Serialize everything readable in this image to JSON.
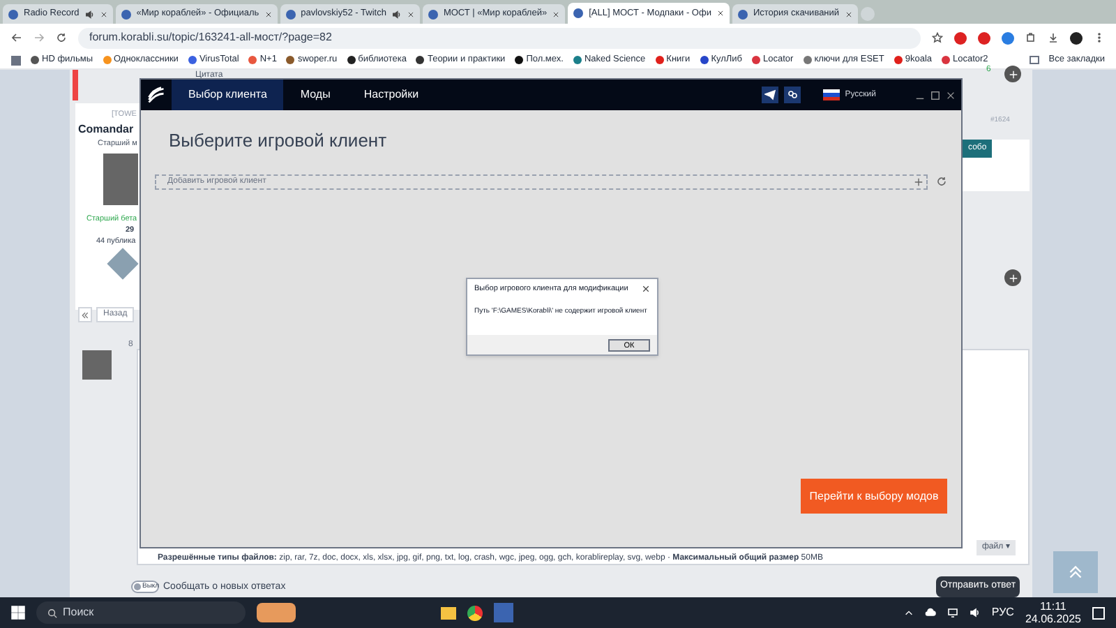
{
  "browser": {
    "tabs": [
      {
        "title": "Radio Record",
        "audio": true,
        "selected": false
      },
      {
        "title": "«Мир кораблей» - Официаль",
        "audio": false,
        "selected": false
      },
      {
        "title": "pavlovskiy52 - Twitch",
        "audio": true,
        "selected": false
      },
      {
        "title": "МОСТ | «Мир кораблей»",
        "audio": false,
        "selected": false
      },
      {
        "title": "[ALL] МОСТ - Модпаки - Офи",
        "audio": false,
        "selected": true
      },
      {
        "title": "История скачиваний",
        "audio": false,
        "selected": false
      }
    ],
    "address": "forum.korabli.su/topic/163241-all-мост/?page=82",
    "bookmarks": [
      {
        "label": "HD фильмы",
        "color": "#555555"
      },
      {
        "label": "Одноклассники",
        "color": "#f7931e"
      },
      {
        "label": "VirusTotal",
        "color": "#3b61e0"
      },
      {
        "label": "N+1",
        "color": "#e8573f"
      },
      {
        "label": "swoper.ru",
        "color": "#8a5a2b"
      },
      {
        "label": "библиотека",
        "color": "#222222"
      },
      {
        "label": "Теории и практики",
        "color": "#333333"
      },
      {
        "label": "Пол.мех.",
        "color": "#111111"
      },
      {
        "label": "Naked Science",
        "color": "#1b7f8a"
      },
      {
        "label": "Книги",
        "color": "#e0201b"
      },
      {
        "label": "КулЛиб",
        "color": "#2746c9"
      },
      {
        "label": "Locator",
        "color": "#d9343f"
      },
      {
        "label": "ключи для ESET",
        "color": "#777777"
      },
      {
        "label": "9koala",
        "color": "#e0201b"
      },
      {
        "label": "Locator2",
        "color": "#d9343f"
      }
    ],
    "all_bookmarks": "Все закладки"
  },
  "forum": {
    "quote_link": "Цитата",
    "clan": "[TOWE",
    "author": "Comandar",
    "title": "Старший м",
    "group": "Старший бета",
    "reputation": "29",
    "posts": "44 публика",
    "back_button": "Назад",
    "reply_time": "8",
    "post_number": "#1624",
    "side_text": "собо",
    "counter": "6",
    "files_note": "**Разрешённые типы файлов:** zip, rar, 7z, doc, docx, xls, xlsx, jpg, gif, png, txt, log, crash, wgc, jpeg, ogg, gch, korablireplay, svg, webp · **Максимальный общий размер** 50MB",
    "attach": "файл ▾",
    "notify_toggle": {
      "label": "Выкл",
      "on": false
    },
    "notify_text": "Сообщать о новых ответах",
    "submit": "Отправить ответ"
  },
  "app": {
    "tabs": [
      {
        "label": "Выбор клиента",
        "selected": true
      },
      {
        "label": "Моды",
        "selected": false
      },
      {
        "label": "Настройки",
        "selected": false
      }
    ],
    "language": "Русский",
    "heading": "Выберите игровой клиент",
    "client_field": {
      "placeholder": "Добавить игровой клиент"
    },
    "next_button": "Перейти к выбору модов"
  },
  "dialog": {
    "title": "Выбор игрового клиента для модификации",
    "message": "Путь 'F:\\GAMES\\Korabli\\' не содержит игровой клиент",
    "ok": "ОК"
  },
  "taskbar": {
    "search": "Поиск",
    "language": "РУС",
    "time": "11:11",
    "date": "24.06.2025"
  }
}
